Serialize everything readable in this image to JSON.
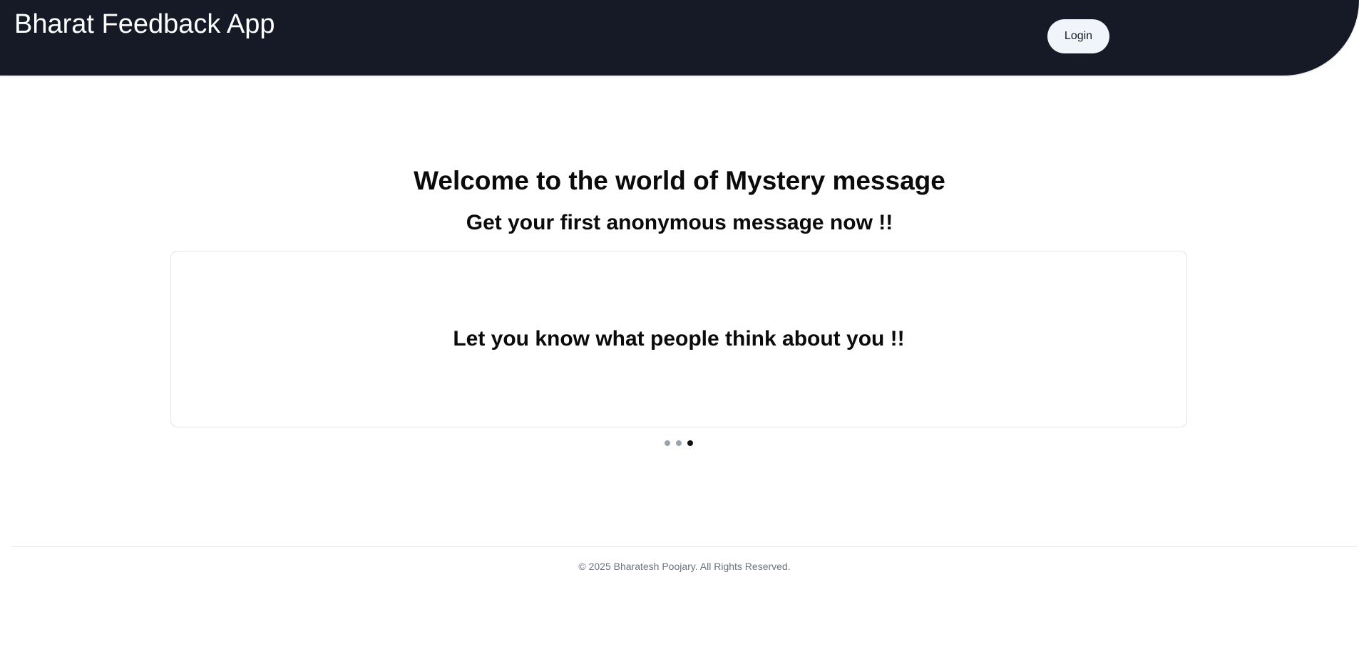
{
  "header": {
    "app_title": "Bharat Feedback App",
    "login_label": "Login",
    "background_color": "#151a26"
  },
  "hero": {
    "title": "Welcome to the world of Mystery message",
    "subtitle": "Get your first anonymous message now !!"
  },
  "carousel": {
    "slides": [
      "",
      "",
      "Let you know what people think about you !!"
    ],
    "current_slide_text": "Let you know what people think about you !!",
    "total_slides": 3,
    "active_index": 2
  },
  "footer": {
    "copyright": "© 2025 Bharatesh Poojary. All Rights Reserved."
  }
}
